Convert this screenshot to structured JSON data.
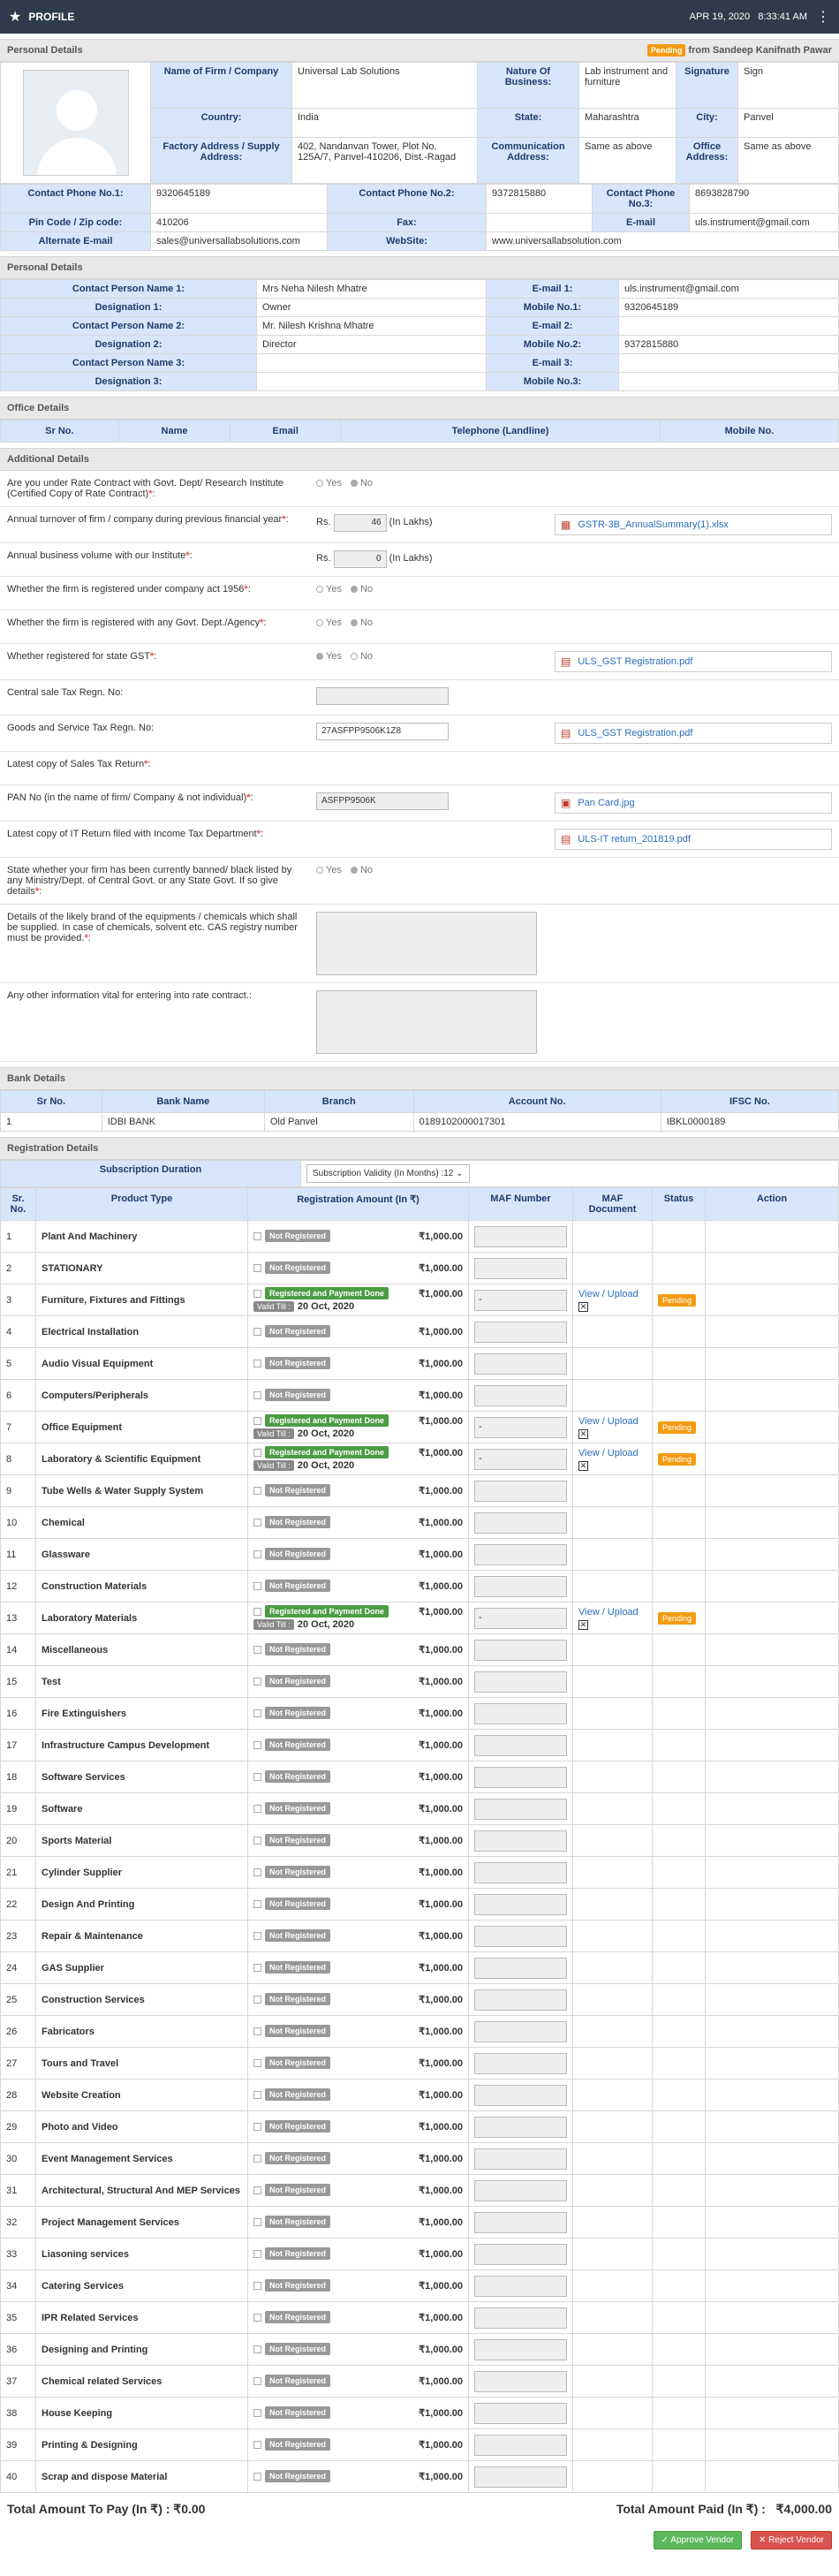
{
  "topbar": {
    "title": "PROFILE",
    "date": "APR 19, 2020",
    "time": "8:33:41 AM"
  },
  "personal": {
    "section_title": "Personal Details",
    "status": "Pending",
    "from_text": "from Sandeep Kanifnath Pawar",
    "firm_label": "Name of Firm / Company",
    "firm": "Universal Lab Solutions",
    "nature_label": "Nature Of Business:",
    "nature": "Lab instrument and furniture",
    "signature_label": "Signature",
    "signature": "Sign",
    "country_label": "Country:",
    "country": "India",
    "state_label": "State:",
    "state": "Maharashtra",
    "city_label": "City:",
    "city": "Panvel",
    "factory_label": "Factory Address / Supply Address:",
    "factory": "402, Nandanvan Tower, Plot No. 125A/7, Panvel-410206, Dist.-Ragad",
    "comm_label": "Communication Address:",
    "comm": "Same as above",
    "office_label": "Office Address:",
    "office": "Same as above",
    "phone1_label": "Contact Phone No.1:",
    "phone1": "9320645189",
    "phone2_label": "Contact Phone No.2:",
    "phone2": "9372815880",
    "phone3_label": "Contact Phone No.3:",
    "phone3": "8693828790",
    "pin_label": "Pin Code / Zip code:",
    "pin": "410206",
    "fax_label": "Fax:",
    "fax": "",
    "email_label": "E-mail",
    "email": "uls.instrument@gmail.com",
    "alt_email_label": "Alternate E-mail",
    "alt_email": "sales@universallabsolutions.com",
    "website_label": "WebSite:",
    "website": "www.universallabsolution.com"
  },
  "contacts": {
    "section_title": "Personal Details",
    "rows": [
      {
        "l1": "Contact Person Name 1:",
        "v1": "Mrs Neha Nilesh Mhatre",
        "l2": "E-mail 1:",
        "v2": "uls.instrument@gmail.com"
      },
      {
        "l1": "Designation 1:",
        "v1": "Owner",
        "l2": "Mobile No.1:",
        "v2": "9320645189"
      },
      {
        "l1": "Contact Person Name 2:",
        "v1": "Mr. Nilesh Krishna Mhatre",
        "l2": "E-mail 2:",
        "v2": ""
      },
      {
        "l1": "Designation 2:",
        "v1": "Director",
        "l2": "Mobile No.2:",
        "v2": "9372815880"
      },
      {
        "l1": "Contact Person Name 3:",
        "v1": "",
        "l2": "E-mail 3:",
        "v2": ""
      },
      {
        "l1": "Designation 3:",
        "v1": "",
        "l2": "Mobile No.3:",
        "v2": ""
      }
    ]
  },
  "office": {
    "section_title": "Office Details",
    "headers": [
      "Sr No.",
      "Name",
      "Email",
      "Telephone (Landline)",
      "Mobile No."
    ]
  },
  "additional": {
    "section_title": "Additional Details",
    "q1": "Are you under Rate Contract with Govt. Dept/ Research Institute (Certified Copy of Rate Contract)",
    "q2": "Annual turnover of firm / company during previous financial year",
    "q2_prefix": "Rs.",
    "q2_val": "46",
    "q2_unit": "(In Lakhs)",
    "q2_file": "GSTR-3B_AnnualSummary(1).xlsx",
    "q3": "Annual business volume with our Institute",
    "q3_prefix": "Rs.",
    "q3_val": "0",
    "q3_unit": "(In Lakhs)",
    "q4": "Whether the firm is registered under company act 1956",
    "q5": "Whether the firm is registered with any Govt. Dept./Agency",
    "q6": "Whether registered for state GST",
    "q6_file": "ULS_GST Registration.pdf",
    "q7": "Central sale Tax Regn. No:",
    "q8": "Goods and Service Tax Regn. No:",
    "q8_val": "27ASFPP9506K1Z8",
    "q8_file": "ULS_GST Registration.pdf",
    "q9": "Latest copy of Sales Tax Return",
    "q10": "PAN No (in the name of firm/ Company & not individual)",
    "q10_val": "ASFPP9506K",
    "q10_file": "Pan Card.jpg",
    "q11": "Latest copy of IT Return filed with Income Tax Department",
    "q11_file": "ULS-IT return_201819.pdf",
    "q12": "State whether your firm has been currently banned/ black listed by any Ministry/Dept. of Central Govt. or any State Govt. If so give details",
    "q13": "Details of the likely brand of the equipments / chemicals which shall be supplied. In case of chemicals, solvent etc. CAS registry number must be provided.",
    "q14": "Any other information vital for entering into rate contract.:",
    "yes": "Yes",
    "no": "No"
  },
  "bank": {
    "section_title": "Bank Details",
    "headers": [
      "Sr No.",
      "Bank Name",
      "Branch",
      "Account No.",
      "IFSC No."
    ],
    "row": [
      "1",
      "IDBI BANK",
      "Old Panvel",
      "0189102000017301",
      "IBKL0000189"
    ]
  },
  "registration": {
    "section_title": "Registration Details",
    "subscription_label": "Subscription Duration",
    "subscription_value": "Subscription Validity (In Months) :12",
    "headers": [
      "Sr. No.",
      "Product Type",
      "Registration Amount (In ₹)",
      "MAF Number",
      "MAF Document",
      "Status",
      "Action"
    ],
    "not_registered": "Not Registered",
    "registered": "Registered and Payment Done",
    "valid_till": "Valid Till :",
    "valid_date": "20 Oct, 2020",
    "view_upload": "View / Upload",
    "status_pending": "Pending",
    "maf_dash": "-",
    "amount": "₹1,000.00",
    "items": [
      "Plant And Machinery",
      "STATIONARY",
      "Furniture, Fixtures and Fittings",
      "Electrical Installation",
      "Audio Visual Equipment",
      "Computers/Peripherals",
      "Office Equipment",
      "Laboratory & Scientific Equipment",
      "Tube Wells & Water Supply System",
      "Chemical",
      "Glassware",
      "Construction Materials",
      "Laboratory Materials",
      "Miscellaneous",
      "Test",
      "Fire Extinguishers",
      "Infrastructure Campus Development",
      "Software Services",
      "Software",
      "Sports Material",
      "Cylinder Supplier",
      "Design And Printing",
      "Repair & Maintenance",
      "GAS Supplier",
      "Construction Services",
      "Fabricators",
      "Tours and Travel",
      "Website Creation",
      "Photo and Video",
      "Event Management Services",
      "Architectural, Structural And MEP Services",
      "Project Management Services",
      "Liasoning services",
      "Catering Services",
      "IPR Related Services",
      "Designing and Printing",
      "Chemical related Services",
      "House Keeping",
      "Printing & Designing",
      "Scrap and dispose Material"
    ],
    "registered_indexes": [
      3,
      7,
      8,
      13
    ]
  },
  "totals": {
    "to_pay_label": "Total Amount To Pay (In ₹) :",
    "to_pay": "₹0.00",
    "paid_label": "Total Amount Paid (In ₹) :",
    "paid": "₹4,000.00"
  },
  "actions": {
    "approve": "Approve Vendor",
    "reject": "Reject Vendor"
  }
}
